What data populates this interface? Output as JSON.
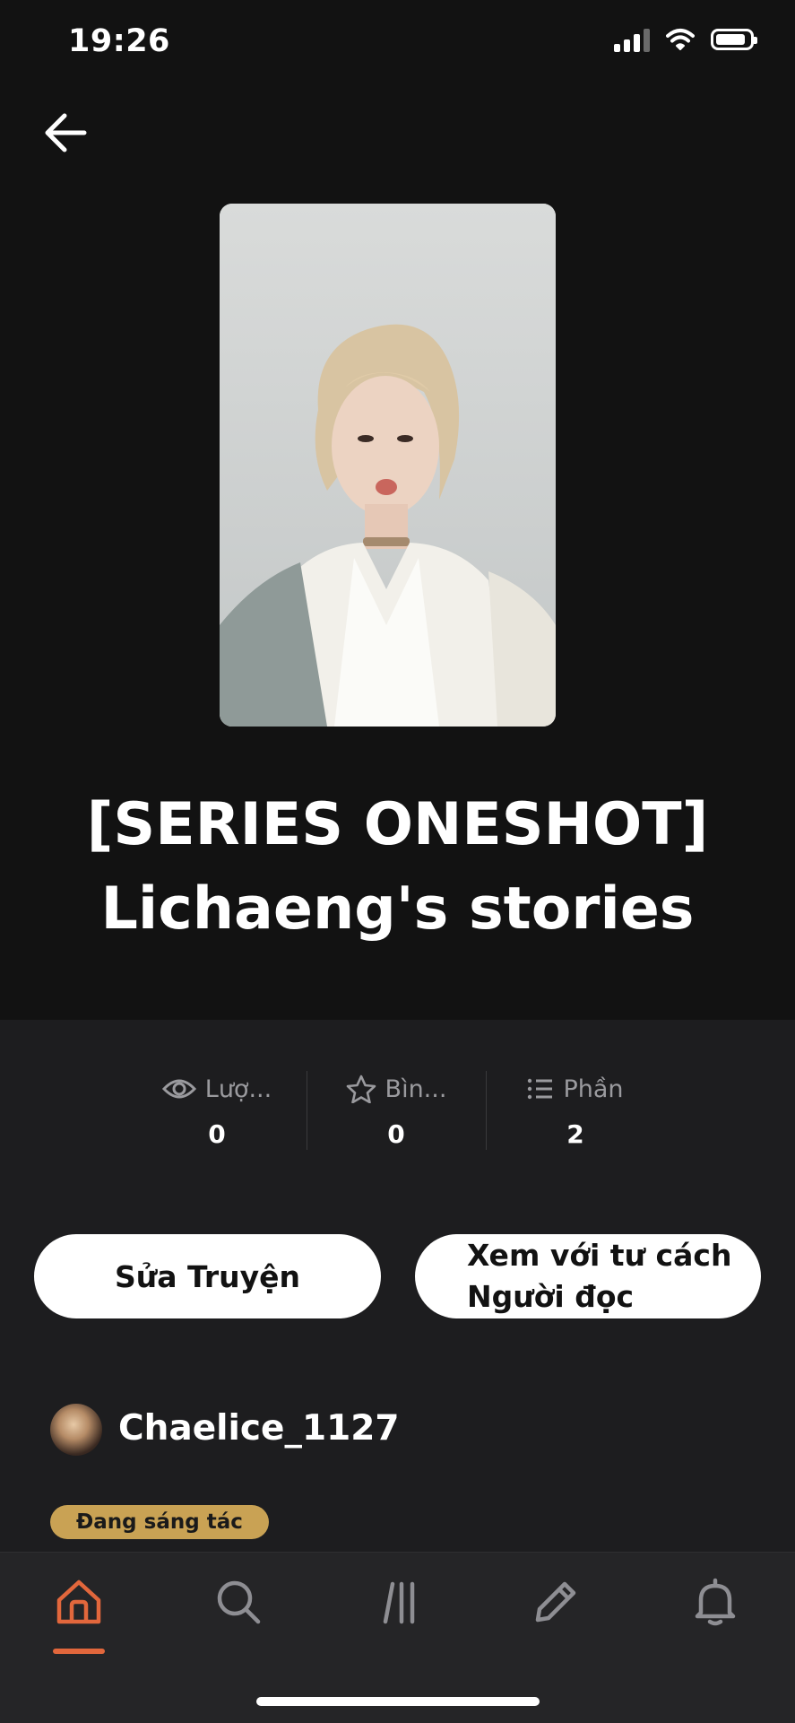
{
  "status_bar": {
    "time": "19:26"
  },
  "story": {
    "title_line1": "[SERIES ONESHOT]",
    "title_line2": "Lichaeng's stories"
  },
  "stats": [
    {
      "label": "Lượ...",
      "value": "0",
      "icon": "eye-icon"
    },
    {
      "label": "Bìn...",
      "value": "0",
      "icon": "star-icon"
    },
    {
      "label": "Phần",
      "value": "2",
      "icon": "list-icon"
    }
  ],
  "actions": {
    "edit_label": "Sửa Truyện",
    "view_as_reader_line1": "Xem với tư cách",
    "view_as_reader_line2": "Người đọc"
  },
  "author": {
    "name": "Chaelice_1127"
  },
  "status_badge": "Đang sáng tác",
  "tabbar": {
    "active": "home",
    "accent": "#e2673c",
    "items": [
      "home-icon",
      "search-icon",
      "library-icon",
      "write-icon",
      "bell-icon"
    ]
  }
}
